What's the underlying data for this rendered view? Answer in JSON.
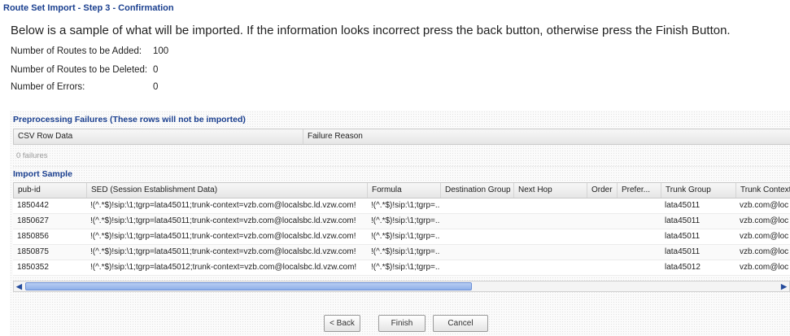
{
  "wizard": {
    "title": "Route Set Import - Step 3 - Confirmation",
    "intro": "Below is a sample of what will be imported. If the information looks incorrect press the back button, otherwise press the Finish Button."
  },
  "stats": [
    {
      "label": "Number of Routes to be Added:",
      "value": "100"
    },
    {
      "label": "Number of Routes to be Deleted:",
      "value": "0"
    },
    {
      "label": "Number of Errors:",
      "value": "0"
    }
  ],
  "preprocessing": {
    "title": "Preprocessing Failures (These rows will not be imported)",
    "columns": [
      "CSV Row Data",
      "Failure Reason"
    ],
    "empty_text": "0 failures"
  },
  "import_sample": {
    "title": "Import Sample",
    "columns": [
      "pub-id",
      "SED (Session Establishment Data)",
      "Formula",
      "Destination Group",
      "Next Hop",
      "Order",
      "Prefer...",
      "Trunk Group",
      "Trunk Context"
    ],
    "rows": [
      [
        "1850442",
        "!(^.*$)!sip:\\1;tgrp=lata45011;trunk-context=vzb.com@localsbc.ld.vzw.com!",
        "!(^.*$)!sip:\\1;tgrp=...",
        "",
        "",
        "",
        "",
        "lata45011",
        "vzb.com@loc"
      ],
      [
        "1850627",
        "!(^.*$)!sip:\\1;tgrp=lata45011;trunk-context=vzb.com@localsbc.ld.vzw.com!",
        "!(^.*$)!sip:\\1;tgrp=...",
        "",
        "",
        "",
        "",
        "lata45011",
        "vzb.com@loc"
      ],
      [
        "1850856",
        "!(^.*$)!sip:\\1;tgrp=lata45011;trunk-context=vzb.com@localsbc.ld.vzw.com!",
        "!(^.*$)!sip:\\1;tgrp=...",
        "",
        "",
        "",
        "",
        "lata45011",
        "vzb.com@loc"
      ],
      [
        "1850875",
        "!(^.*$)!sip:\\1;tgrp=lata45011;trunk-context=vzb.com@localsbc.ld.vzw.com!",
        "!(^.*$)!sip:\\1;tgrp=...",
        "",
        "",
        "",
        "",
        "lata45011",
        "vzb.com@loc"
      ],
      [
        "1850352",
        "!(^.*$)!sip:\\1;tgrp=lata45012;trunk-context=vzb.com@localsbc.ld.vzw.com!",
        "!(^.*$)!sip:\\1;tgrp=...",
        "",
        "",
        "",
        "",
        "lata45012",
        "vzb.com@loc"
      ]
    ],
    "scroll_left_icon": "chevron-left-icon",
    "scroll_right_icon": "chevron-right-icon"
  },
  "buttons": {
    "back": "< Back",
    "finish": "Finish",
    "cancel": "Cancel"
  },
  "colors": {
    "section_title": "#1a3f8f",
    "scroll_thumb": "#8fb0ea"
  }
}
